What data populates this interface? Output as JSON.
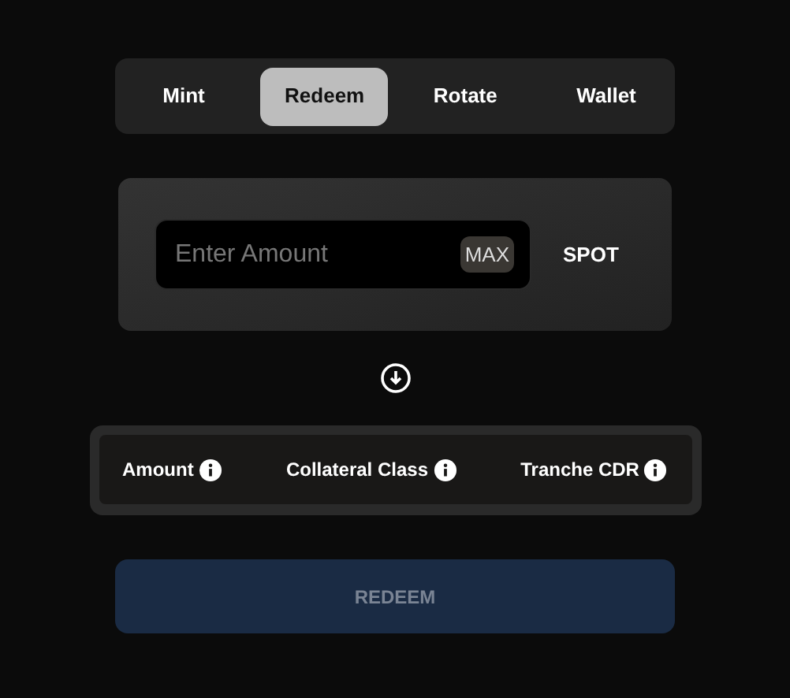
{
  "tabs": [
    {
      "label": "Mint",
      "selected": false
    },
    {
      "label": "Redeem",
      "selected": true
    },
    {
      "label": "Rotate",
      "selected": false
    },
    {
      "label": "Wallet",
      "selected": false
    }
  ],
  "amount_input": {
    "placeholder": "Enter Amount",
    "max_button": "MAX",
    "token": "SPOT"
  },
  "table": {
    "columns": [
      {
        "label": "Amount"
      },
      {
        "label": "Collateral Class"
      },
      {
        "label": "Tranche CDR"
      }
    ]
  },
  "submit_button": {
    "label": "REDEEM",
    "disabled": true
  }
}
